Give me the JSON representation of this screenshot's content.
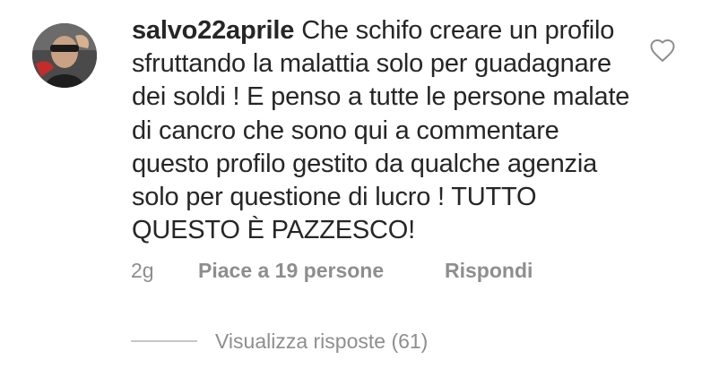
{
  "comment": {
    "username": "salvo22aprile",
    "text": "Che schifo creare un profilo sfruttando la malattia solo per guadagnare dei soldi ! E penso a tutte le persone malate di cancro che sono qui a commentare questo profilo gestito da qualche agenzia solo per questione di lucro ! TUTTO QUESTO È PAZZESCO!",
    "like_icon": "heart-outline-icon"
  },
  "meta": {
    "time": "2g",
    "likes": "Piace a 19 persone",
    "reply": "Rispondi"
  },
  "replies": {
    "label": "Visualizza risposte (61)"
  }
}
